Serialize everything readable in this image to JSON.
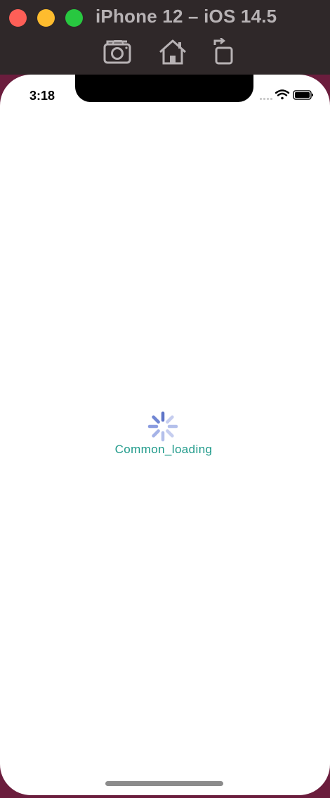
{
  "window": {
    "title": "iPhone 12 – iOS 14.5",
    "toolbar": {
      "screenshot_icon": "camera-icon",
      "home_icon": "home-icon",
      "rotate_icon": "rotate-icon"
    },
    "colors": {
      "close": "#fe5f57",
      "minimize": "#febc2e",
      "zoom": "#28c840"
    }
  },
  "status_bar": {
    "time": "3:18",
    "icons": [
      "signal-icon",
      "wifi-icon",
      "battery-icon"
    ]
  },
  "content": {
    "loading_text": "Common_loading",
    "spinner_icon": "spinner-icon",
    "accent": "#1f9a8a",
    "spinner_color": "#7b8fd6"
  }
}
